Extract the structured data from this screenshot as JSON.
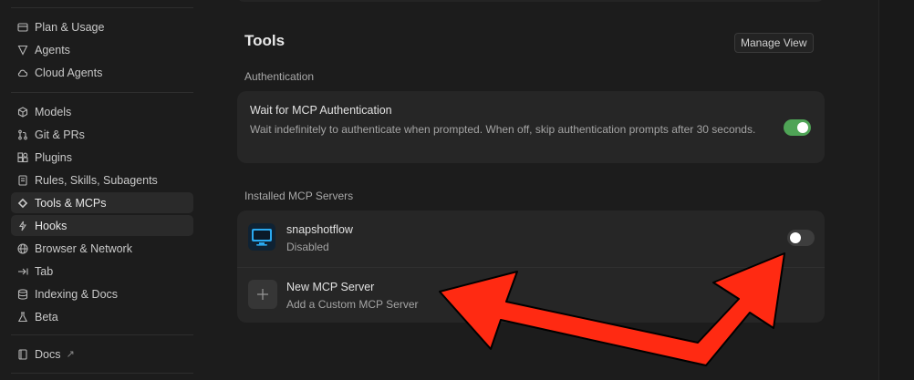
{
  "sidebar": {
    "items": [
      {
        "label": "Plan & Usage",
        "icon": "card-icon"
      },
      {
        "label": "Agents",
        "icon": "agents-icon"
      },
      {
        "label": "Cloud Agents",
        "icon": "cloud-icon"
      },
      {
        "label": "Models",
        "icon": "cube-icon"
      },
      {
        "label": "Git & PRs",
        "icon": "git-icon"
      },
      {
        "label": "Plugins",
        "icon": "plugins-icon"
      },
      {
        "label": "Rules, Skills, Subagents",
        "icon": "document-icon"
      },
      {
        "label": "Tools & MCPs",
        "icon": "tools-icon",
        "active": true
      },
      {
        "label": "Hooks",
        "icon": "hooks-icon"
      },
      {
        "label": "Browser & Network",
        "icon": "globe-icon"
      },
      {
        "label": "Tab",
        "icon": "tab-arrow-icon"
      },
      {
        "label": "Indexing & Docs",
        "icon": "database-icon"
      },
      {
        "label": "Beta",
        "icon": "flask-icon"
      },
      {
        "label": "Docs",
        "icon": "book-icon",
        "external": "↗"
      }
    ]
  },
  "main": {
    "title": "Tools",
    "manage_view_label": "Manage View",
    "authentication": {
      "section_label": "Authentication",
      "wait_title": "Wait for MCP Authentication",
      "wait_desc": "Wait indefinitely to authenticate when prompted. When off, skip authentication prompts after 30 seconds.",
      "wait_enabled": true
    },
    "installed": {
      "section_label": "Installed MCP Servers",
      "servers": [
        {
          "name": "snapshotflow",
          "status": "Disabled",
          "enabled": false,
          "icon": "monitor-icon"
        }
      ],
      "new_server": {
        "title": "New MCP Server",
        "subtitle": "Add a Custom MCP Server",
        "icon": "plus-icon"
      }
    }
  },
  "colors": {
    "toggle_on": "#4fa456",
    "toggle_off": "#3d3d3d",
    "annotation_arrow": "#ff2a12"
  }
}
